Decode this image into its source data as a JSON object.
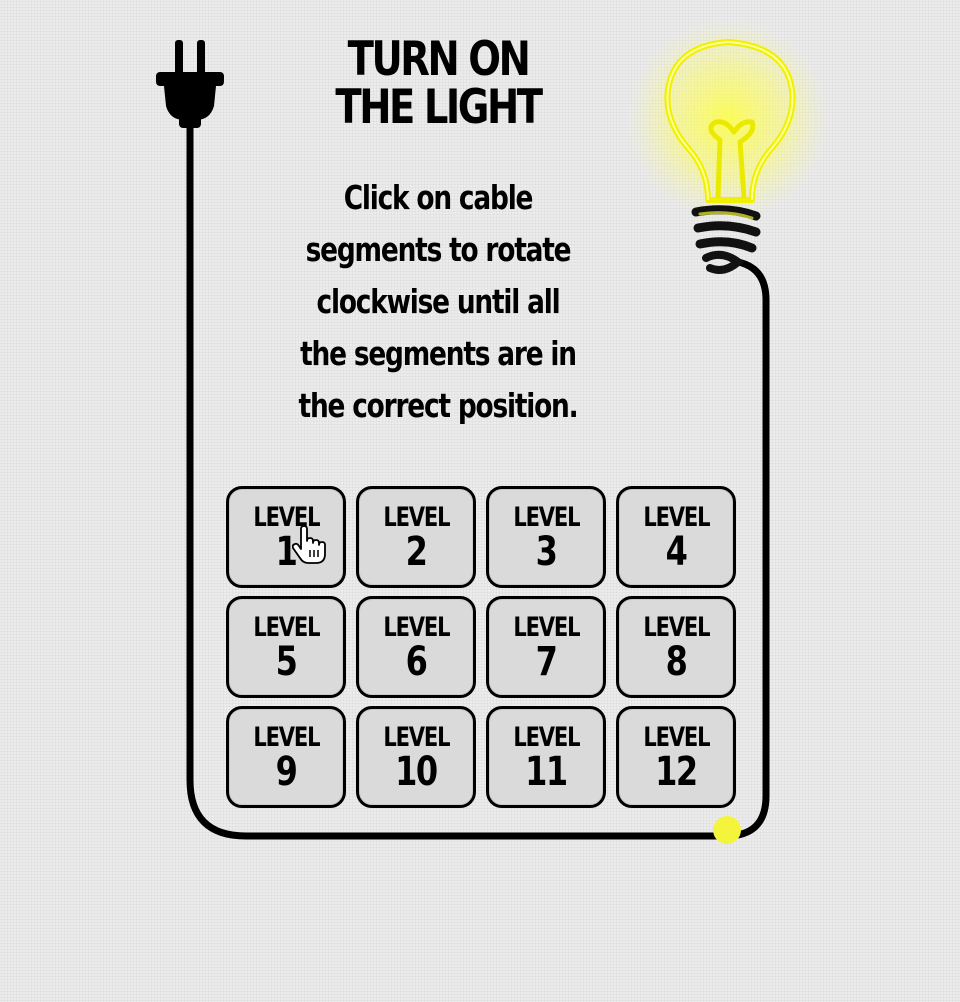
{
  "title": {
    "line1": "TURN ON",
    "line2": "THE LIGHT"
  },
  "instructions": {
    "lines": [
      "Click on cable",
      "segments to rotate",
      "clockwise until all",
      "the segments are in",
      "the correct position."
    ]
  },
  "levels": [
    {
      "label": "LEVEL",
      "number": "1"
    },
    {
      "label": "LEVEL",
      "number": "2"
    },
    {
      "label": "LEVEL",
      "number": "3"
    },
    {
      "label": "LEVEL",
      "number": "4"
    },
    {
      "label": "LEVEL",
      "number": "5"
    },
    {
      "label": "LEVEL",
      "number": "6"
    },
    {
      "label": "LEVEL",
      "number": "7"
    },
    {
      "label": "LEVEL",
      "number": "8"
    },
    {
      "label": "LEVEL",
      "number": "9"
    },
    {
      "label": "LEVEL",
      "number": "10"
    },
    {
      "label": "LEVEL",
      "number": "11"
    },
    {
      "label": "LEVEL",
      "number": "12"
    }
  ],
  "icons": {
    "plug": "plug-icon",
    "bulb": "light-bulb-icon",
    "cursor": "hand-pointer-icon",
    "cable_end": "cable-end-dot"
  },
  "colors": {
    "cable": "#000000",
    "bulb_glow": "#ffff33",
    "cable_end": "#f4f43c",
    "button_fill": "#dadada",
    "background": "#ececec"
  }
}
